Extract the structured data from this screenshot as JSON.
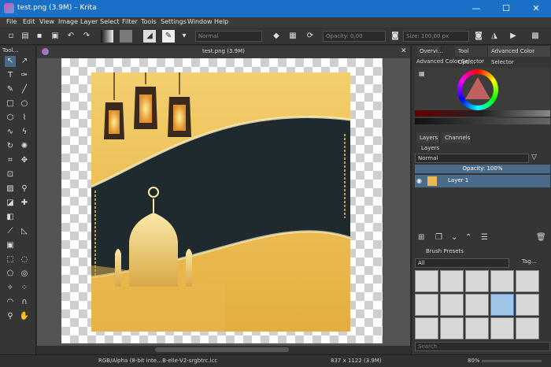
{
  "window": {
    "title": "test.png (3.9M)  –  Krita",
    "minimize": "—",
    "maximize": "☐",
    "close": "✕"
  },
  "menu": [
    "File",
    "Edit",
    "View",
    "Image",
    "Layer",
    "Select",
    "Filter",
    "Tools",
    "Settings",
    "Window",
    "Help"
  ],
  "toolbar": {
    "blend_mode": "Normal",
    "opacity_label": "Opacity: 0,00",
    "size_label": "Size: 100,00 px"
  },
  "toolbox": {
    "title": "Tool…"
  },
  "document": {
    "tab_title": "test.png (3.9M)"
  },
  "right_panel": {
    "tabs": [
      "Overvi…",
      "Tool Opti…",
      "Advanced Color Selector"
    ],
    "color_selector_title": "Advanced Color Selector",
    "layers_tabs": [
      "Layers",
      "Channels"
    ],
    "layers_title": "Layers",
    "blend_mode": "Normal",
    "opacity": "Opacity: 100%",
    "layer_name": "Layer 1",
    "brush_presets_title": "Brush Presets",
    "brush_filter": "All",
    "brush_tag": "Tag…",
    "search_placeholder": "Search"
  },
  "status": {
    "color_space": "RGB/Alpha (8-bit inte…B-elle-V2-srgbtrc.icc",
    "dimensions": "837 x 1122 (3.9M)",
    "zoom": "80%"
  },
  "colors": {
    "titlebar": "#1a70c6",
    "gold": "#e8b84a",
    "dark": "#1f2a2e",
    "accent": "#4a8bc8"
  }
}
